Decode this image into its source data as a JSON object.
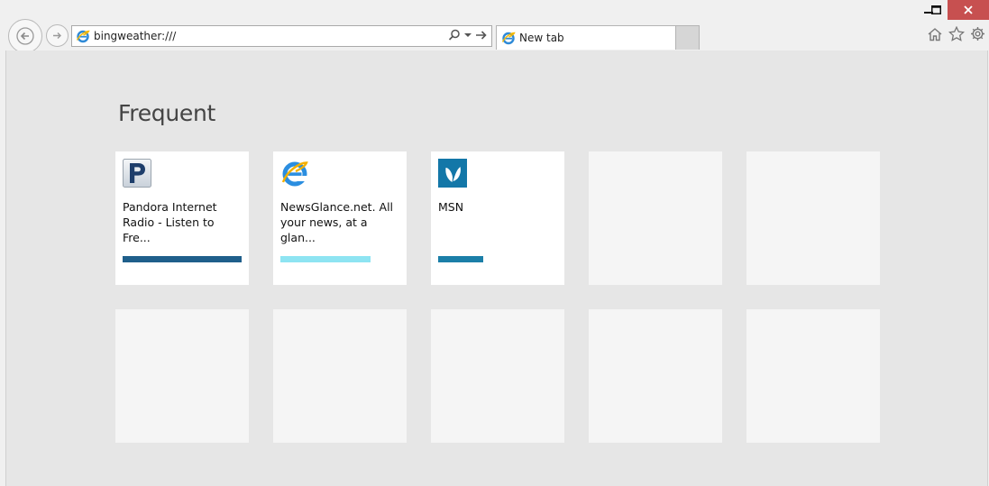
{
  "browser": {
    "address": {
      "value": "bingweather:///"
    },
    "tab": {
      "label": "New tab",
      "close_glyph": "×"
    },
    "icons": {
      "back": "arrow-left-icon",
      "forward": "arrow-right-icon",
      "search": "search-icon",
      "go": "arrow-right-icon",
      "home": "home-icon",
      "favorites": "star-icon",
      "settings": "gear-icon"
    },
    "accent_close": "#c75050"
  },
  "new_tab_page": {
    "section_title": "Frequent",
    "tiles": [
      {
        "title": "Pandora Internet\nRadio - Listen to Fre...",
        "icon": "pandora-icon",
        "bar_color": "#1f5f8b",
        "activity": 1.0
      },
      {
        "title": "NewsGlance.net. All\nyour news, at a glan...",
        "icon": "ie-icon",
        "bar_color": "#8ee4f2",
        "activity": 0.75
      },
      {
        "title": "MSN",
        "icon": "msn-butterfly-icon",
        "bar_color": "#1b7fa8",
        "activity": 0.38
      }
    ]
  }
}
